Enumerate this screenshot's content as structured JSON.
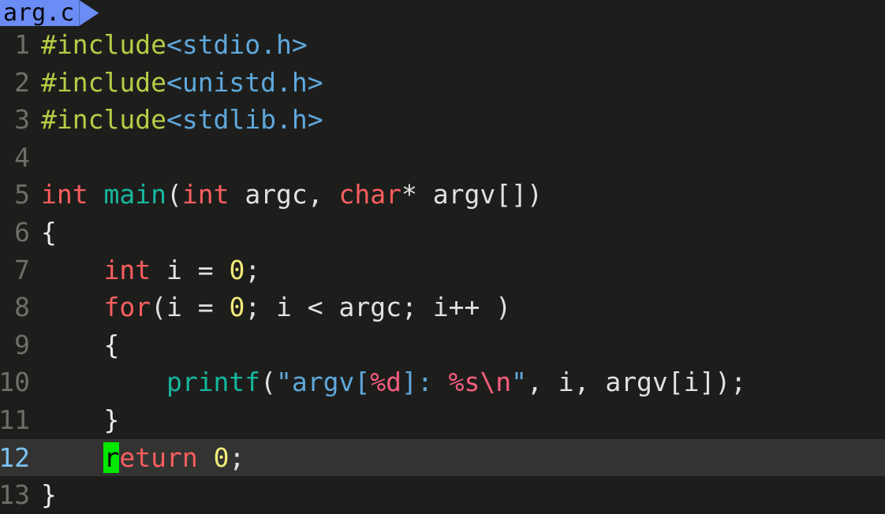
{
  "window": {
    "title": "arg.c",
    "background_color": "#1d1e1c"
  },
  "tabline": {
    "tabs": [
      {
        "label": "arg.c",
        "active": true,
        "background_color": "#6b8cf5",
        "text_color": "#07080a"
      }
    ]
  },
  "editor": {
    "filename": "arg.c",
    "language": "c",
    "cursor": {
      "line": 12,
      "column": 5,
      "character": "r",
      "block_color": "#00e800"
    },
    "cursorline_color": "#333432",
    "gutter": {
      "number_color": "#6e6e6a",
      "current_number_color": "#7cc4f0",
      "numbers": [
        "1",
        "2",
        "3",
        "4",
        "5",
        "6",
        "7",
        "8",
        "9",
        "10",
        "11",
        "12",
        "13"
      ]
    },
    "palette": {
      "background": "#1d1e1c",
      "preprocessor": "#b5cc45",
      "include_path": "#5fa8dc",
      "keyword_type": "#fa5e5e",
      "function": "#15b79e",
      "plain": "#dfe3e0",
      "number": "#f2ec79",
      "string": "#5fa8dc",
      "format_specifier": "#fa5e7e",
      "brace": "#e8ecea"
    },
    "lines": [
      {
        "number": "1",
        "text": "#include<stdio.h>"
      },
      {
        "number": "2",
        "text": "#include<unistd.h>"
      },
      {
        "number": "3",
        "text": "#include<stdlib.h>"
      },
      {
        "number": "4",
        "text": ""
      },
      {
        "number": "5",
        "text": "int main(int argc, char* argv[])"
      },
      {
        "number": "6",
        "text": "{"
      },
      {
        "number": "7",
        "text": "    int i = 0;"
      },
      {
        "number": "8",
        "text": "    for(i = 0; i < argc; i++ )"
      },
      {
        "number": "9",
        "text": "    {"
      },
      {
        "number": "10",
        "text": "        printf(\"argv[%d]: %s\\n\", i, argv[i]);"
      },
      {
        "number": "11",
        "text": "    }"
      },
      {
        "number": "12",
        "text": "    return 0;",
        "current": true
      },
      {
        "number": "13",
        "text": "}"
      }
    ]
  }
}
